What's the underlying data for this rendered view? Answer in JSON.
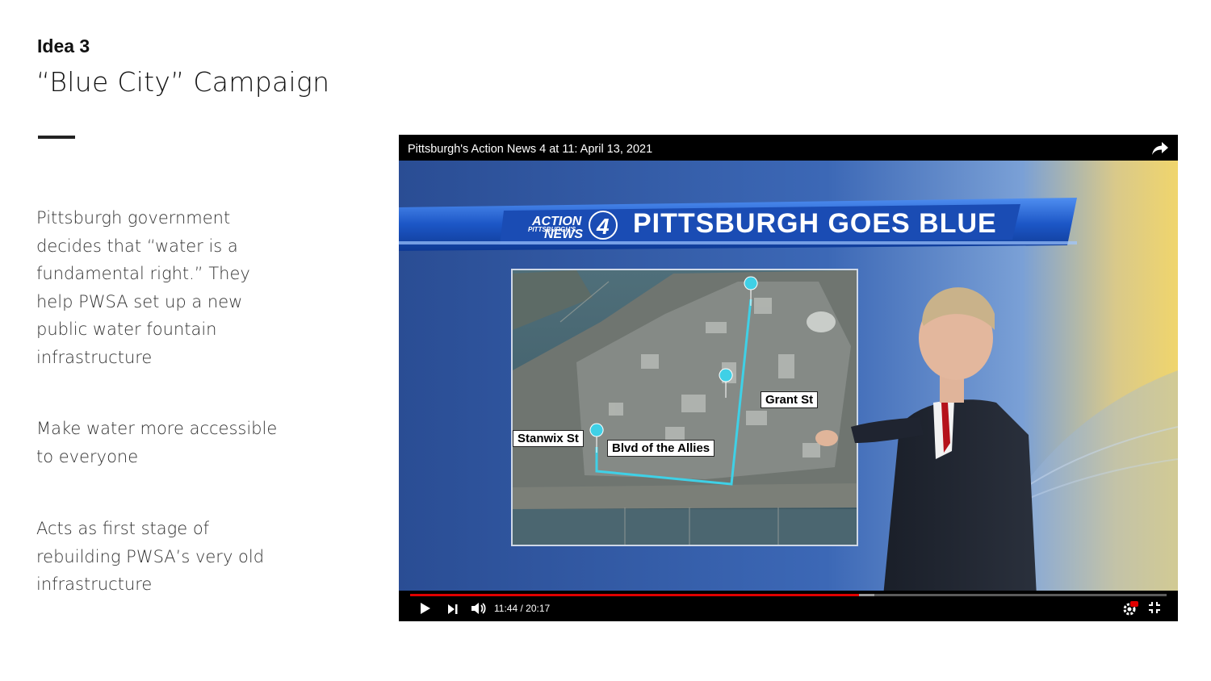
{
  "slide": {
    "kicker": "Idea 3",
    "title": "“Blue City” Campaign",
    "paragraphs": [
      "Pittsburgh government decides that “water is a fundamental right.” They help PWSA set up a new public water fountain infrastructure",
      "Make water more accessible to everyone",
      "Acts as first  stage of rebuilding PWSA’s very old infrastructure"
    ]
  },
  "video": {
    "title": "Pittsburgh's Action News 4 at 11: April 13, 2021",
    "share_icon": "share-arrow-icon",
    "banner": "PITTSBURGH GOES BLUE",
    "logo": {
      "line1": "PITTSBURGH'S",
      "line2": "ACTION",
      "line3": "NEWS",
      "number": "4"
    },
    "map_labels": {
      "grant": "Grant St",
      "stanwix": "Stanwix St",
      "blvd": "Blvd of the Allies"
    },
    "time": "11:44 / 20:17",
    "progress_played": 0.593,
    "progress_buffered": 0.614,
    "colors": {
      "progress": "#e00000",
      "banner_blue": "#1f5fd0",
      "route": "#3fd0e6"
    }
  }
}
